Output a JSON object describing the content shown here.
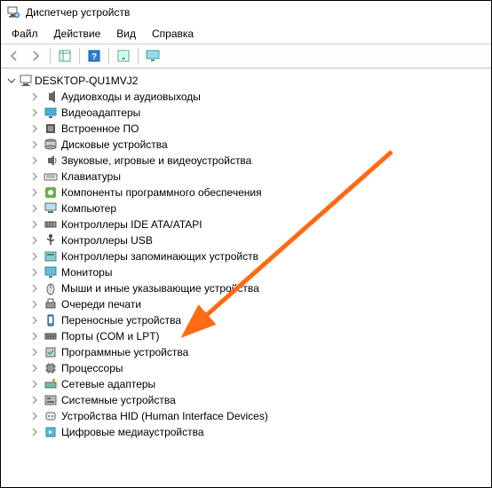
{
  "window": {
    "title": "Диспетчер устройств"
  },
  "menu": {
    "file": "Файл",
    "action": "Действие",
    "view": "Вид",
    "help": "Справка"
  },
  "tree": {
    "root": "DESKTOP-QU1MVJ2",
    "items": [
      {
        "icon": "audio",
        "label": "Аудиовходы и аудиовыходы"
      },
      {
        "icon": "display",
        "label": "Видеоадаптеры"
      },
      {
        "icon": "firmware",
        "label": "Встроенное ПО"
      },
      {
        "icon": "disk",
        "label": "Дисковые устройства"
      },
      {
        "icon": "sound",
        "label": "Звуковые, игровые и видеоустройства"
      },
      {
        "icon": "keyboard",
        "label": "Клавиатуры"
      },
      {
        "icon": "software",
        "label": "Компоненты программного обеспечения"
      },
      {
        "icon": "computer",
        "label": "Компьютер"
      },
      {
        "icon": "ide",
        "label": "Контроллеры IDE ATA/ATAPI"
      },
      {
        "icon": "usb",
        "label": "Контроллеры USB"
      },
      {
        "icon": "storage",
        "label": "Контроллеры запоминающих устройств"
      },
      {
        "icon": "monitor",
        "label": "Мониторы"
      },
      {
        "icon": "mouse",
        "label": "Мыши и иные указывающие устройства"
      },
      {
        "icon": "printqueue",
        "label": "Очереди печати"
      },
      {
        "icon": "portable",
        "label": "Переносные устройства"
      },
      {
        "icon": "ports",
        "label": "Порты (COM и LPT)"
      },
      {
        "icon": "softdev",
        "label": "Программные устройства"
      },
      {
        "icon": "cpu",
        "label": "Процессоры"
      },
      {
        "icon": "network",
        "label": "Сетевые адаптеры"
      },
      {
        "icon": "system",
        "label": "Системные устройства"
      },
      {
        "icon": "hid",
        "label": "Устройства HID (Human Interface Devices)"
      },
      {
        "icon": "media",
        "label": "Цифровые медиаустройства"
      }
    ]
  }
}
